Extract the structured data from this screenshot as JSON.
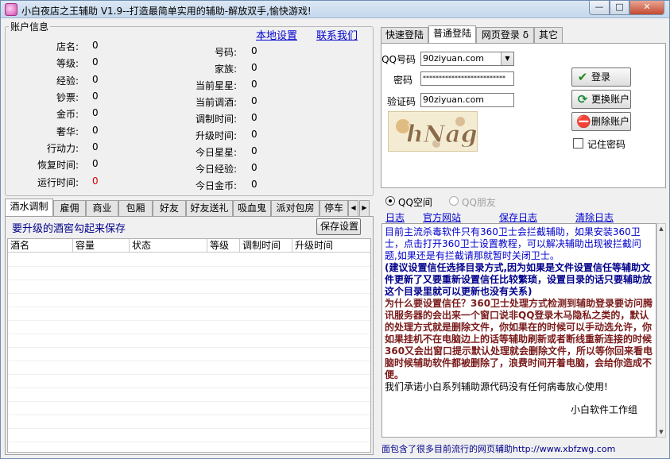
{
  "window": {
    "title": "小白夜店之王辅助 V1.9--打造最简单实用的辅助-解放双手,愉快游戏!"
  },
  "account": {
    "group_title": "账户信息",
    "link_local_settings": "本地设置",
    "link_contact": "联系我们",
    "left_fields": [
      {
        "label": "店名:",
        "value": "0"
      },
      {
        "label": "等级:",
        "value": "0"
      },
      {
        "label": "经验:",
        "value": "0"
      },
      {
        "label": "钞票:",
        "value": "0"
      },
      {
        "label": "金币:",
        "value": "0"
      },
      {
        "label": "奢华:",
        "value": "0"
      },
      {
        "label": "行动力:",
        "value": "0"
      },
      {
        "label": "恢复时间:",
        "value": "0"
      },
      {
        "label": "运行时间:",
        "value": "0"
      }
    ],
    "right_fields": [
      {
        "label": "号码:",
        "value": "0"
      },
      {
        "label": "家族:",
        "value": "0"
      },
      {
        "label": "当前星星:",
        "value": "0"
      },
      {
        "label": "当前调酒:",
        "value": "0"
      },
      {
        "label": "调制时间:",
        "value": "0"
      },
      {
        "label": "升级时间:",
        "value": "0"
      },
      {
        "label": "今日星星:",
        "value": "0"
      },
      {
        "label": "今日经验:",
        "value": "0"
      },
      {
        "label": "今日金币:",
        "value": "0"
      }
    ]
  },
  "login": {
    "tabs": [
      "快速登陆",
      "普通登陆",
      "网页登录 δ",
      "其它"
    ],
    "qq_label": "QQ号码",
    "qq_value": "90ziyuan.com",
    "password_label": "密码",
    "password_value": "**************************",
    "captcha_label": "验证码",
    "captcha_value": "90ziyuan.com",
    "captcha_text": "hNag",
    "btn_login": "登录",
    "btn_switch": "更换账户",
    "btn_delete": "删除账户",
    "remember_label": "记住密码",
    "remember_checked": false
  },
  "radios": {
    "qzone": "QQ空间",
    "pengyou": "QQ朋友"
  },
  "func_tabs": [
    "酒水调制",
    "雇佣",
    "商业",
    "包厢",
    "好友",
    "好友送礼",
    "吸血鬼",
    "派对包房",
    "停车"
  ],
  "drink": {
    "hint": "要升级的酒窖勾起来保存",
    "save_btn": "保存设置",
    "columns": [
      "酒名",
      "容量",
      "状态",
      "等级",
      "调制时间",
      "升级时间"
    ]
  },
  "log": {
    "links": [
      "日志",
      "官方网站",
      "保存日志",
      "清除日志"
    ],
    "blue_text": "目前主流杀毒软件只有360卫士会拦截辅助，如果安装360卫士，点击打开360卫士设置教程，可以解决辅助出现被拦截问题,如果还是有拦截请那就暂时关闭卫士。",
    "navy_text": "(建议设置信任选择目录方式,因为如果是文件设置信任等辅助文件更新了又要重新设置信任比较繁琐，设置目录的话只要辅助放这个目录里就可以更新也没有关系)",
    "brown_text": "为什么要设置信任？360卫士处理方式检测到辅助登录要访问腾讯服务器的会出来一个窗口说非QQ登录木马隐私之类的，默认的处理方式就是删除文件，你如果在的时候可以手动选允许，你如果挂机不在电脑边上的话等辅助刷新或者断线重新连接的时候360又会出窗口提示默认处理就会删除文件，所以等你回来看电脑时候辅助软件都被删除了，浪费时间开着电脑，会给你造成不便。",
    "black_text": "我们承诺小白系列辅助源代码没有任何病毒放心使用!",
    "signature": "小白软件工作组",
    "status_line": "面包含了很多目前流行的网页辅助http://www.xbfzwg.com"
  },
  "colors": {
    "title_bar": "#c4d7ec",
    "link_blue": "#0000cc",
    "red_value": "#d00000",
    "close_btn": "#c54a30"
  }
}
